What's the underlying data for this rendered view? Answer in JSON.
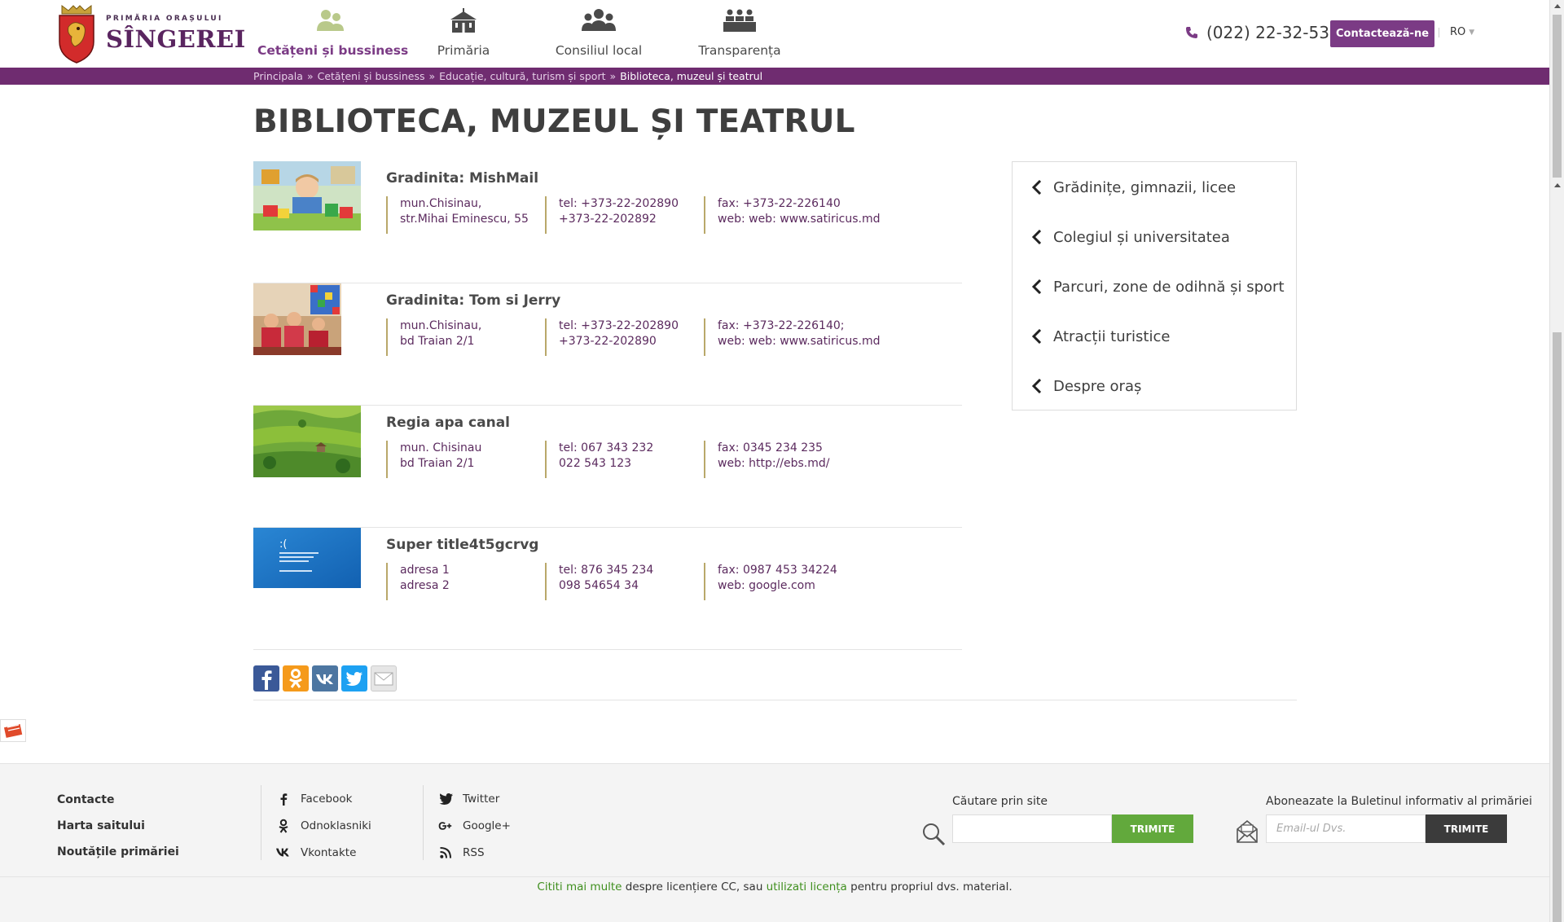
{
  "logo": {
    "supertitle": "PRIMĂRIA ORAȘULUI",
    "name": "SÎNGEREI"
  },
  "nav": {
    "items": [
      {
        "label": "Cetățeni și bussiness",
        "icon": "citizens-icon",
        "active": true
      },
      {
        "label": "Primăria",
        "icon": "city-hall-icon",
        "active": false
      },
      {
        "label": "Consiliul local",
        "icon": "council-icon",
        "active": false
      },
      {
        "label": "Transparența",
        "icon": "transparency-icon",
        "active": false
      }
    ]
  },
  "header": {
    "phone": "(022) 22-32-53",
    "contact_label": "Contactează-ne",
    "lang": "RO"
  },
  "breadcrumb": {
    "items": [
      "Principala",
      "Cetățeni și bussiness",
      "Educație, cultură, turism și sport"
    ],
    "separator": "»",
    "current": "Biblioteca, muzeul și teatrul"
  },
  "page": {
    "title": "BIBLIOTECA, MUZEUL ȘI TEATRUL"
  },
  "entries": [
    {
      "title": "Gradinita: MishMail",
      "address": [
        "mun.Chisinau,",
        "str.Mihai Eminescu, 55"
      ],
      "tel": [
        "tel: +373-22-202890",
        "+373-22-202892"
      ],
      "fax": [
        "fax: +373-22-226140",
        "web: web: www.satiricus.md"
      ]
    },
    {
      "title": "Gradinita: Tom si Jerry",
      "address": [
        "mun.Chisinau,",
        "bd Traian 2/1"
      ],
      "tel": [
        "tel: +373-22-202890",
        "+373-22-202890"
      ],
      "fax": [
        "fax: +373-22-226140;",
        "web: web: www.satiricus.md"
      ]
    },
    {
      "title": "Regia apa canal",
      "address": [
        "mun. Chisinau",
        "bd Traian 2/1"
      ],
      "tel": [
        "tel: 067 343 232",
        "022 543 123"
      ],
      "fax": [
        "fax: 0345 234 235",
        "web: http://ebs.md/"
      ]
    },
    {
      "title": "Super title4t5gcrvg",
      "address": [
        "adresa 1",
        "adresa 2"
      ],
      "tel": [
        "tel: 876 345 234",
        "098 54654 34"
      ],
      "fax": [
        "fax: 0987 453 34224",
        "web: google.com"
      ]
    }
  ],
  "sidebar": {
    "links": [
      "Grădinițe, gimnazii, licee",
      "Colegiul și universitatea",
      "Parcuri, zone de odihnă și sport",
      "Atracții turistice",
      "Despre oraș"
    ]
  },
  "share": {
    "buttons": [
      "facebook-icon",
      "odnoklassniki-icon",
      "vk-icon",
      "twitter-icon",
      "email-icon"
    ],
    "colors": {
      "facebook": "#3b5998",
      "odnoklassniki": "#f59a1b",
      "vk": "#4d76a1",
      "twitter": "#1da1f2",
      "email": "#e6e6e6"
    }
  },
  "footer": {
    "links": [
      "Contacte",
      "Harta saitului",
      "Noutățile primăriei"
    ],
    "social_col1": [
      {
        "label": "Facebook",
        "icon": "facebook-icon"
      },
      {
        "label": "Odnoklasniki",
        "icon": "odnoklassniki-icon"
      },
      {
        "label": "Vkontakte",
        "icon": "vk-icon"
      }
    ],
    "social_col2": [
      {
        "label": "Twitter",
        "icon": "twitter-icon"
      },
      {
        "label": "Google+",
        "icon": "google-plus-icon"
      },
      {
        "label": "RSS",
        "icon": "rss-icon"
      }
    ],
    "search": {
      "title": "Căutare prin site",
      "placeholder": "",
      "button": "TRIMITE"
    },
    "subscribe": {
      "title": "Aboneazate la Buletinul informativ al primăriei",
      "placeholder": "Email-ul Dvs.",
      "button": "TRIMITE"
    },
    "license": {
      "link1": "Cititi mai multe",
      "text1": " despre licențiere CC, sau ",
      "link2": "utilizati licența",
      "text2": " pentru propriul dvs. material."
    }
  },
  "colors": {
    "brand": "#6f2c70",
    "accent": "#7b3b85",
    "green": "#62a93c",
    "gold_divider": "#b9a86a"
  }
}
